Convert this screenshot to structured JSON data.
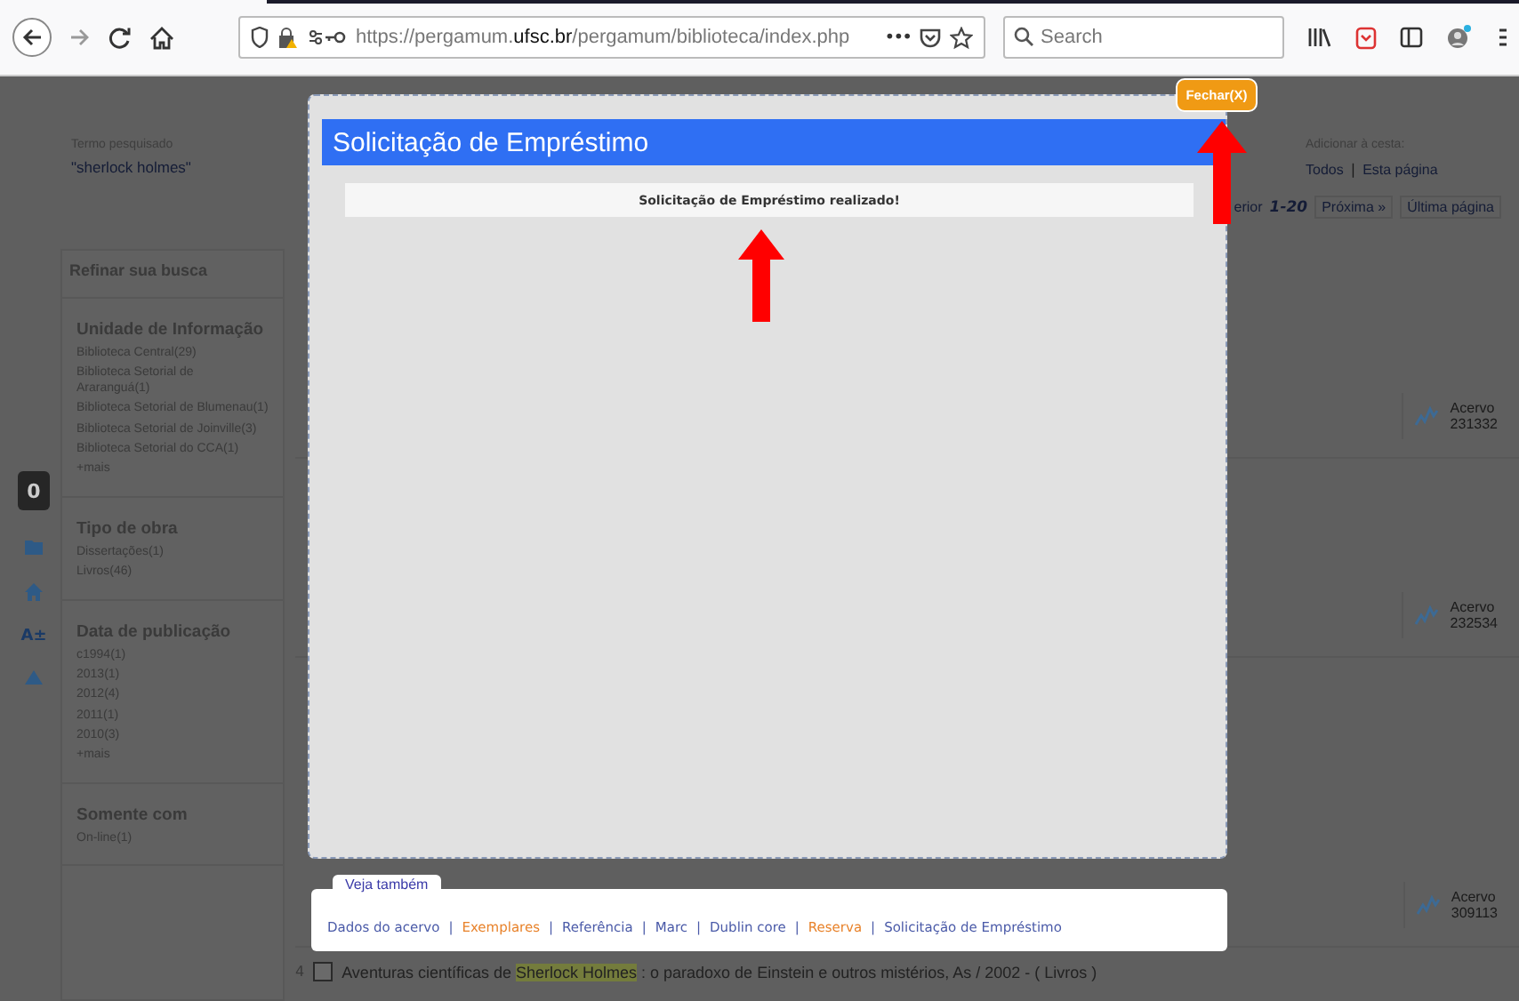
{
  "browser": {
    "url": [
      {
        "text": "https://pergamum.",
        "emphasis": false
      },
      {
        "text": "ufsc.br",
        "emphasis": true
      },
      {
        "text": "/pergamum/biblioteca/index.php",
        "emphasis": false
      }
    ],
    "page_actions": "•••",
    "search": {
      "placeholder": "Search"
    }
  },
  "left_strip": {
    "badge": "0",
    "font_button": "A±"
  },
  "search_summary": {
    "label": "Termo pesquisado",
    "term": "\"sherlock holmes\""
  },
  "cart": {
    "label": "Adicionar à cesta:",
    "links": [
      "Todos",
      "Esta página"
    ],
    "separator": "|"
  },
  "pagination": [
    {
      "text": "erior",
      "kind": "link"
    },
    {
      "text": "1-20",
      "kind": "current"
    },
    {
      "text": "Próxima »",
      "kind": "button"
    },
    {
      "text": "Última página",
      "kind": "button"
    }
  ],
  "sidebar": {
    "title": "Refinar sua busca",
    "groups": [
      {
        "title": "Unidade de Informação",
        "items": [
          "Biblioteca Central(29)",
          "Biblioteca Setorial de Araranguá(1)",
          "Biblioteca Setorial de Blumenau(1)",
          "Biblioteca Setorial de Joinville(3)",
          "Biblioteca Setorial do CCA(1)",
          "+mais"
        ]
      },
      {
        "title": "Tipo de obra",
        "items": [
          "Dissertações(1)",
          "Livros(46)"
        ]
      },
      {
        "title": "Data de publicação",
        "items": [
          "c1994(1)",
          "2013(1)",
          "2012(4)",
          "2011(1)",
          "2010(3)",
          "+mais"
        ]
      },
      {
        "title": "Somente com",
        "items": [
          "On-line(1)"
        ]
      }
    ]
  },
  "results": [
    {
      "acervo_label": "Acervo",
      "acervo_number": "231332"
    },
    {
      "acervo_label": "Acervo",
      "acervo_number": "232534"
    },
    {
      "acervo_label": "Acervo",
      "acervo_number": "309113"
    }
  ],
  "visible_result": {
    "number": "4",
    "checked": false,
    "title": [
      {
        "text": "Aventuras científicas de ",
        "highlight": false
      },
      {
        "text": "Sherlock Holmes",
        "highlight": true
      },
      {
        "text": " : o paradoxo de Einstein e outros mistérios, As / 2002 - ( Livros )",
        "highlight": false
      }
    ]
  },
  "modal": {
    "title": "Solicitação de Empréstimo",
    "message": "Solicitação de Empréstimo realizado!",
    "close": "Fechar(X)"
  },
  "see_also": {
    "title": "Veja também",
    "separator": "|",
    "links": [
      {
        "text": "Dados do acervo",
        "color": "#4a5aa8"
      },
      {
        "text": "Exemplares",
        "color": "#e8822a"
      },
      {
        "text": "Referência",
        "color": "#4a5aa8"
      },
      {
        "text": "Marc",
        "color": "#4a5aa8"
      },
      {
        "text": "Dublin core",
        "color": "#4a5aa8"
      },
      {
        "text": "Reserva",
        "color": "#e8822a"
      },
      {
        "text": "Solicitação de Empréstimo",
        "color": "#4a5aa8"
      }
    ]
  }
}
